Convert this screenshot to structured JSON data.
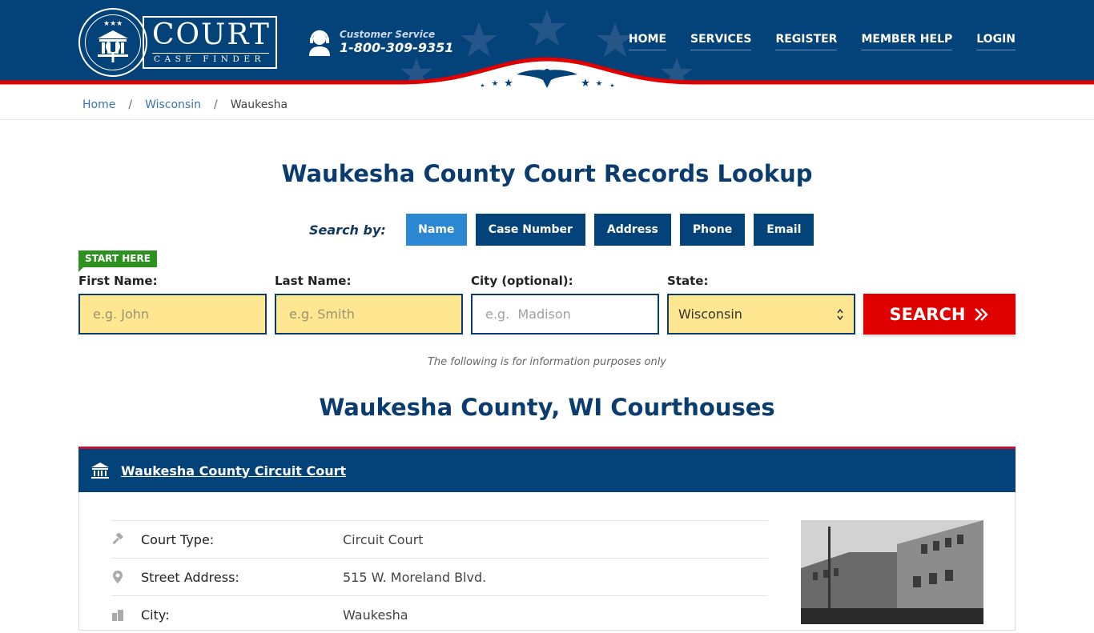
{
  "header": {
    "logo": {
      "title": "COURT",
      "subtitle": "CASE FINDER"
    },
    "customer_service": {
      "label": "Customer Service",
      "phone": "1-800-309-9351"
    },
    "nav": [
      "HOME",
      "SERVICES",
      "REGISTER",
      "MEMBER HELP",
      "LOGIN"
    ],
    "colors": {
      "primary": "#04427a",
      "accent_red": "#e00000"
    }
  },
  "breadcrumb": {
    "items": [
      "Home",
      "Wisconsin"
    ],
    "current": "Waukesha",
    "separator": "/"
  },
  "main": {
    "title": "Waukesha County Court Records Lookup",
    "search_by": {
      "label": "Search by:",
      "options": [
        "Name",
        "Case Number",
        "Address",
        "Phone",
        "Email"
      ],
      "active": "Name"
    },
    "start_here": "START HERE",
    "form": {
      "first_name": {
        "label": "First Name:",
        "placeholder": "e.g. John",
        "value": ""
      },
      "last_name": {
        "label": "Last Name:",
        "placeholder": "e.g. Smith",
        "value": ""
      },
      "city": {
        "label": "City (optional):",
        "placeholder": "e.g.  Madison",
        "value": ""
      },
      "state": {
        "label": "State:",
        "value": "Wisconsin"
      },
      "search_button": "SEARCH"
    },
    "info_note": "The following is for information purposes only",
    "section_title": "Waukesha County, WI Courthouses"
  },
  "court": {
    "name": "Waukesha County Circuit Court",
    "rows": [
      {
        "icon": "gavel-icon",
        "label": "Court Type:",
        "value": "Circuit Court"
      },
      {
        "icon": "map-pin-icon",
        "label": "Street Address:",
        "value": "515 W. Moreland Blvd."
      },
      {
        "icon": "building-icon",
        "label": "City:",
        "value": "Waukesha"
      }
    ]
  }
}
